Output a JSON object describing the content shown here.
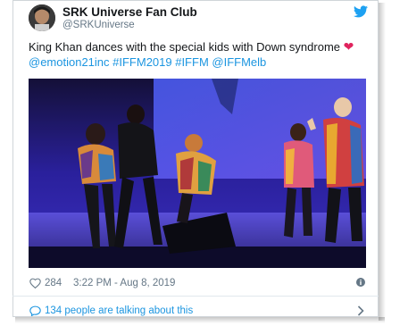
{
  "tweet": {
    "display_name": "SRK Universe Fan Club",
    "handle": "@SRKUniverse",
    "text_main": "King Khan dances with the special kids with Down syndrome",
    "heart_emoji": "❤",
    "hashtags_line": "@emotion21inc #IFFM2019 #IFFM @IFFMelb",
    "likes": "284",
    "timestamp": "3:22 PM - Aug 8, 2019",
    "talking": "134 people are talking about this"
  },
  "icons": {
    "brand": "twitter-bird-icon",
    "like": "heart-icon",
    "info": "info-icon",
    "conversation": "speech-bubble-icon",
    "more": "chevron-right-icon"
  },
  "colors": {
    "link": "#1b95e0",
    "muted": "#657786",
    "heart": "#e0245e",
    "stage": "#2a2090"
  }
}
